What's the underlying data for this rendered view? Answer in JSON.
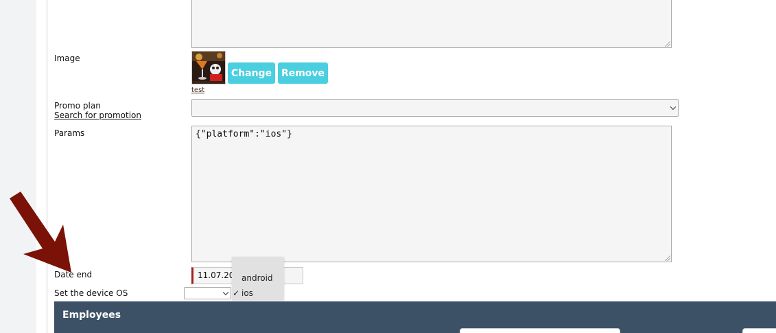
{
  "form": {
    "image": {
      "label": "Image",
      "change_label": "Change",
      "remove_label": "Remove",
      "caption": "test"
    },
    "promo_plan": {
      "label": "Promo plan",
      "search_link": "Search for promotion",
      "selected_value": ""
    },
    "params": {
      "label": "Params",
      "value": "{\"platform\":\"ios\"}"
    },
    "date_end": {
      "label": "Date end",
      "value": "11.07.20"
    },
    "device_os": {
      "label": "Set the device OS",
      "selected_value": "",
      "options": [
        {
          "label": "android",
          "checked": false
        },
        {
          "label": "ios",
          "checked": true
        }
      ],
      "check_mark": "✓"
    }
  },
  "employees": {
    "title": "Employees"
  },
  "colors": {
    "button_accent": "#49cfe0",
    "header_bar": "#3d5166",
    "annotation_arrow": "#7a1208",
    "required_marker": "#a21d1d"
  },
  "icons": {
    "annotation": "arrow-down-right-icon",
    "select_chevron": "chevron-down-icon",
    "check": "check-icon"
  }
}
